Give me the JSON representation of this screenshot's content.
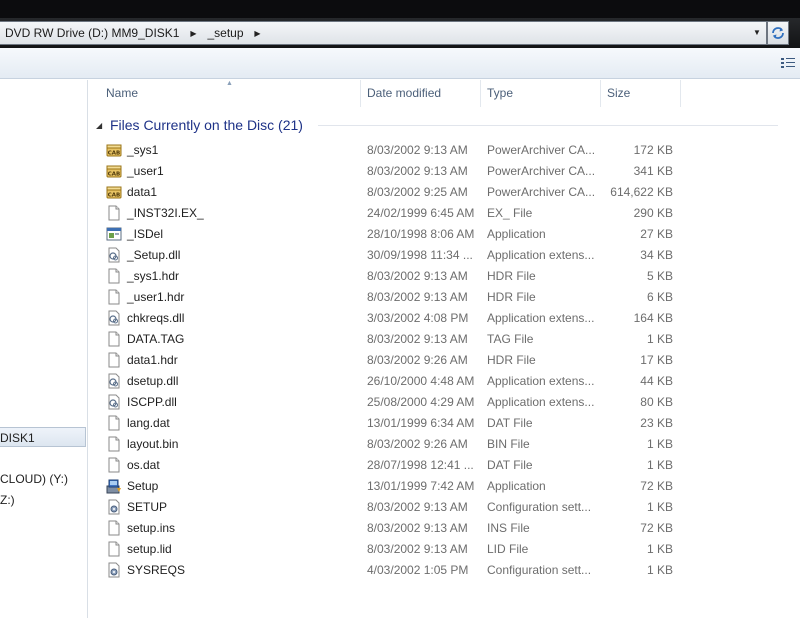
{
  "address": {
    "crumbs": [
      "DVD RW Drive (D:) MM9_DISK1",
      "_setup"
    ]
  },
  "nav": {
    "items": [
      {
        "label": "DISK1",
        "selected": true
      },
      {
        "label": "CLOUD) (Y:)",
        "selected": false
      },
      {
        "label": "Z:)",
        "selected": false
      }
    ]
  },
  "columns": {
    "name": "Name",
    "date": "Date modified",
    "type": "Type",
    "size": "Size"
  },
  "group": {
    "title": "Files Currently on the Disc (21)"
  },
  "files": [
    {
      "name": "_sys1",
      "date": "8/03/2002 9:13 AM",
      "type": "PowerArchiver CA...",
      "size": "172 KB",
      "icon": "cab-archive-icon"
    },
    {
      "name": "_user1",
      "date": "8/03/2002 9:13 AM",
      "type": "PowerArchiver CA...",
      "size": "341 KB",
      "icon": "cab-archive-icon"
    },
    {
      "name": "data1",
      "date": "8/03/2002 9:25 AM",
      "type": "PowerArchiver CA...",
      "size": "614,622 KB",
      "icon": "cab-archive-icon"
    },
    {
      "name": "_INST32I.EX_",
      "date": "24/02/1999 6:45 AM",
      "type": "EX_ File",
      "size": "290 KB",
      "icon": "blank-file-icon"
    },
    {
      "name": "_ISDel",
      "date": "28/10/1998 8:06 AM",
      "type": "Application",
      "size": "27 KB",
      "icon": "application-icon"
    },
    {
      "name": "_Setup.dll",
      "date": "30/09/1998 11:34 ...",
      "type": "Application extens...",
      "size": "34 KB",
      "icon": "dll-icon"
    },
    {
      "name": "_sys1.hdr",
      "date": "8/03/2002 9:13 AM",
      "type": "HDR File",
      "size": "5 KB",
      "icon": "blank-file-icon"
    },
    {
      "name": "_user1.hdr",
      "date": "8/03/2002 9:13 AM",
      "type": "HDR File",
      "size": "6 KB",
      "icon": "blank-file-icon"
    },
    {
      "name": "chkreqs.dll",
      "date": "3/03/2002 4:08 PM",
      "type": "Application extens...",
      "size": "164 KB",
      "icon": "dll-icon"
    },
    {
      "name": "DATA.TAG",
      "date": "8/03/2002 9:13 AM",
      "type": "TAG File",
      "size": "1 KB",
      "icon": "blank-file-icon"
    },
    {
      "name": "data1.hdr",
      "date": "8/03/2002 9:26 AM",
      "type": "HDR File",
      "size": "17 KB",
      "icon": "blank-file-icon"
    },
    {
      "name": "dsetup.dll",
      "date": "26/10/2000 4:48 AM",
      "type": "Application extens...",
      "size": "44 KB",
      "icon": "dll-icon"
    },
    {
      "name": "ISCPP.dll",
      "date": "25/08/2000 4:29 AM",
      "type": "Application extens...",
      "size": "80 KB",
      "icon": "dll-icon"
    },
    {
      "name": "lang.dat",
      "date": "13/01/1999 6:34 AM",
      "type": "DAT File",
      "size": "23 KB",
      "icon": "blank-file-icon"
    },
    {
      "name": "layout.bin",
      "date": "8/03/2002 9:26 AM",
      "type": "BIN File",
      "size": "1 KB",
      "icon": "blank-file-icon"
    },
    {
      "name": "os.dat",
      "date": "28/07/1998 12:41 ...",
      "type": "DAT File",
      "size": "1 KB",
      "icon": "blank-file-icon"
    },
    {
      "name": "Setup",
      "date": "13/01/1999 7:42 AM",
      "type": "Application",
      "size": "72 KB",
      "icon": "setup-installer-icon"
    },
    {
      "name": "SETUP",
      "date": "8/03/2002 9:13 AM",
      "type": "Configuration sett...",
      "size": "1 KB",
      "icon": "config-file-icon"
    },
    {
      "name": "setup.ins",
      "date": "8/03/2002 9:13 AM",
      "type": "INS File",
      "size": "72 KB",
      "icon": "blank-file-icon"
    },
    {
      "name": "setup.lid",
      "date": "8/03/2002 9:13 AM",
      "type": "LID File",
      "size": "1 KB",
      "icon": "blank-file-icon"
    },
    {
      "name": "SYSREQS",
      "date": "4/03/2002 1:05 PM",
      "type": "Configuration sett...",
      "size": "1 KB",
      "icon": "config-file-icon"
    }
  ],
  "colors": {
    "group_title": "#1e3287",
    "header_text": "#4c607a",
    "meta_text": "#6d6d6d"
  }
}
